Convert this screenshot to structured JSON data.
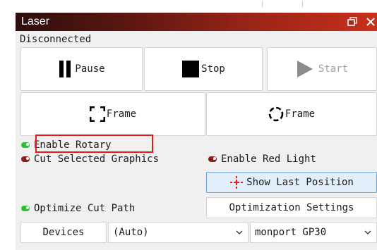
{
  "window": {
    "title": "Laser",
    "status": "Disconnected"
  },
  "controls": {
    "pause_label": "Pause",
    "stop_label": "Stop",
    "start_label": "Start",
    "frame_square_label": "Frame",
    "frame_circle_label": "Frame"
  },
  "options": {
    "enable_rotary": {
      "label": "Enable Rotary",
      "enabled": true
    },
    "cut_selected_graphics": {
      "label": "Cut Selected Graphics",
      "enabled": false
    },
    "enable_red_light": {
      "label": "Enable Red Light",
      "enabled": false
    },
    "optimize_cut_path": {
      "label": "Optimize Cut Path",
      "enabled": true
    }
  },
  "show_last_position_label": "Show Last Position",
  "optimization_settings_label": "Optimization Settings",
  "devices": {
    "button_label": "Devices",
    "port_value": "(Auto)",
    "device_value": "monport GP30"
  },
  "colors": {
    "indicator_on": "#2fbf34",
    "indicator_off": "#8a1f1a",
    "highlight_box": "#e21a1a",
    "crosshair": "#e02020"
  },
  "icons": [
    "pause-icon",
    "stop-icon",
    "start-icon",
    "frame-square-icon",
    "frame-circle-icon",
    "crosshair-icon",
    "restore-icon",
    "close-icon",
    "chevron-down-icon"
  ]
}
